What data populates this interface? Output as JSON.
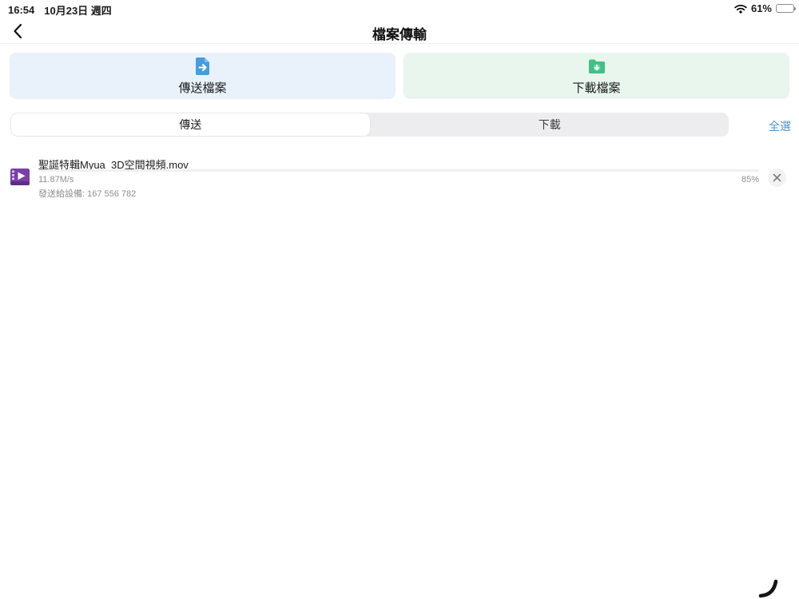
{
  "status_bar": {
    "time": "16:54",
    "date": "10月23日 週四",
    "battery_percent": "61%",
    "battery_level": 61
  },
  "header": {
    "title": "檔案傳輸"
  },
  "action_cards": {
    "send": {
      "label": "傳送檔案"
    },
    "download": {
      "label": "下載檔案"
    }
  },
  "tab_bar": {
    "tabs": [
      {
        "label": "傳送",
        "selected": true
      },
      {
        "label": "下載",
        "selected": false
      }
    ],
    "select_all": "全選"
  },
  "transfers": [
    {
      "filename": "聖誕特輯Myua_3D空間視頻.mov",
      "speed": "11.87M/s",
      "percent_label": "85%",
      "progress": 85,
      "detail": "發送給設備: 167 556 782"
    }
  ],
  "icons": {
    "close_glyph": "✕"
  },
  "colors": {
    "accent_blue": "#3288c4",
    "icon_blue": "#459de0",
    "icon_green": "#3fc183",
    "icon_purple": "#7b3fa9",
    "card_blue_bg": "#e9f2fb",
    "card_green_bg": "#e8f6ee",
    "link_blue": "#4a96d2"
  }
}
